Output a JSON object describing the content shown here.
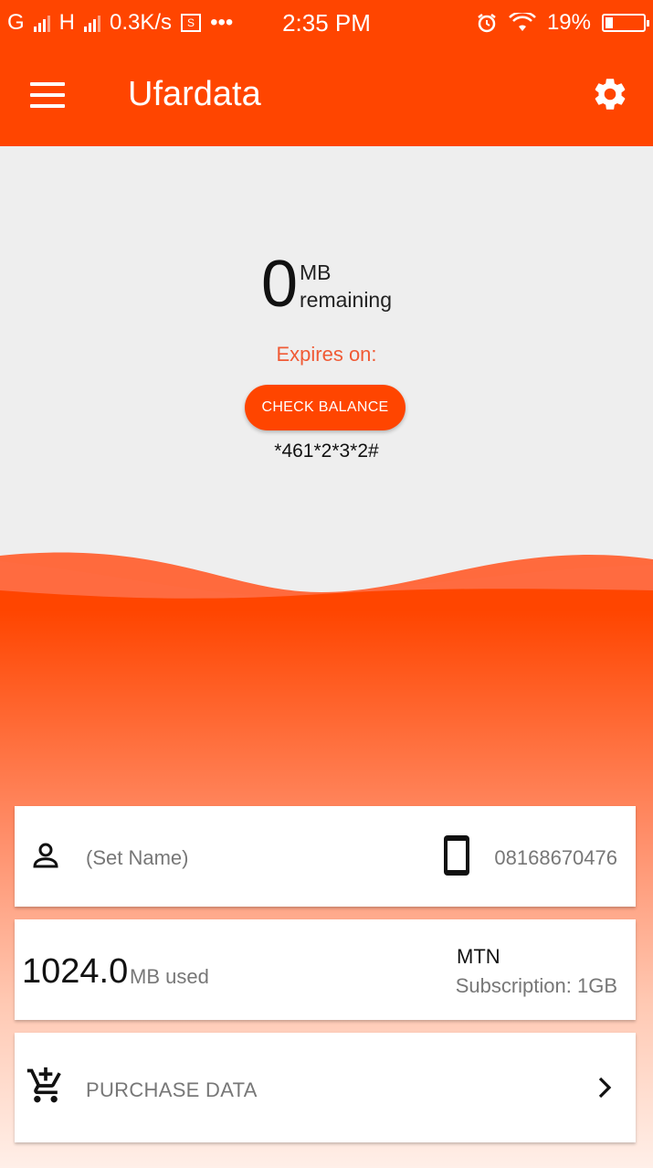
{
  "status_bar": {
    "network1": "G",
    "network2": "H",
    "speed": "0.3K/s",
    "more": "•••",
    "time": "2:35 PM",
    "battery": "19%"
  },
  "app_bar": {
    "title": "Ufardata"
  },
  "balance": {
    "amount": "0",
    "unit": "MB",
    "label": "remaining",
    "expires_label": "Expires on:",
    "check_button": "CHECK BALANCE",
    "ussd_code": "*461*2*3*2#"
  },
  "profile_card": {
    "name": "(Set Name)",
    "phone": "08168670476"
  },
  "usage_card": {
    "used_amount": "1024.0",
    "used_label": "MB used",
    "network": "MTN",
    "subscription": "Subscription: 1GB"
  },
  "purchase_card": {
    "label": "PURCHASE DATA"
  },
  "colors": {
    "primary": "#ff4500",
    "accent_text": "#f05a35",
    "background_top": "#eeeeee"
  }
}
